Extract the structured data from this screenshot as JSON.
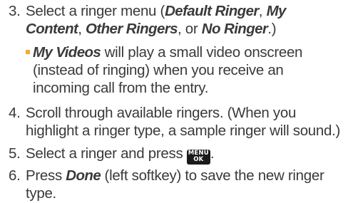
{
  "steps": [
    {
      "number": "3.",
      "text_before": "Select a ringer menu (",
      "term1": "Default Ringer",
      "sep1": ", ",
      "term2": "My Content",
      "sep2": ", ",
      "term3": "Other Ringers",
      "sep3": ", or ",
      "term4": "No Ringer",
      "text_after": ".)"
    },
    {
      "bullet_term": "My Videos",
      "bullet_text": " will play a small video onscreen (instead of ringing) when you receive an incoming call from the entry."
    },
    {
      "number": "4.",
      "text": "Scroll through available ringers. (When you highlight a ringer type, a sample ringer will sound.)"
    },
    {
      "number": "5.",
      "text_before": "Select a ringer and press ",
      "key_line1": "MENU",
      "key_line2": "OK",
      "text_after": "."
    },
    {
      "number": "6.",
      "text_before": "Press ",
      "term": "Done",
      "text_after": " (left softkey) to save the new ringer type."
    }
  ],
  "colors": {
    "text": "#3a3a3a",
    "bullet": "#f2a93b",
    "key_background": "#1a1a1a",
    "key_text": "#ffffff"
  }
}
